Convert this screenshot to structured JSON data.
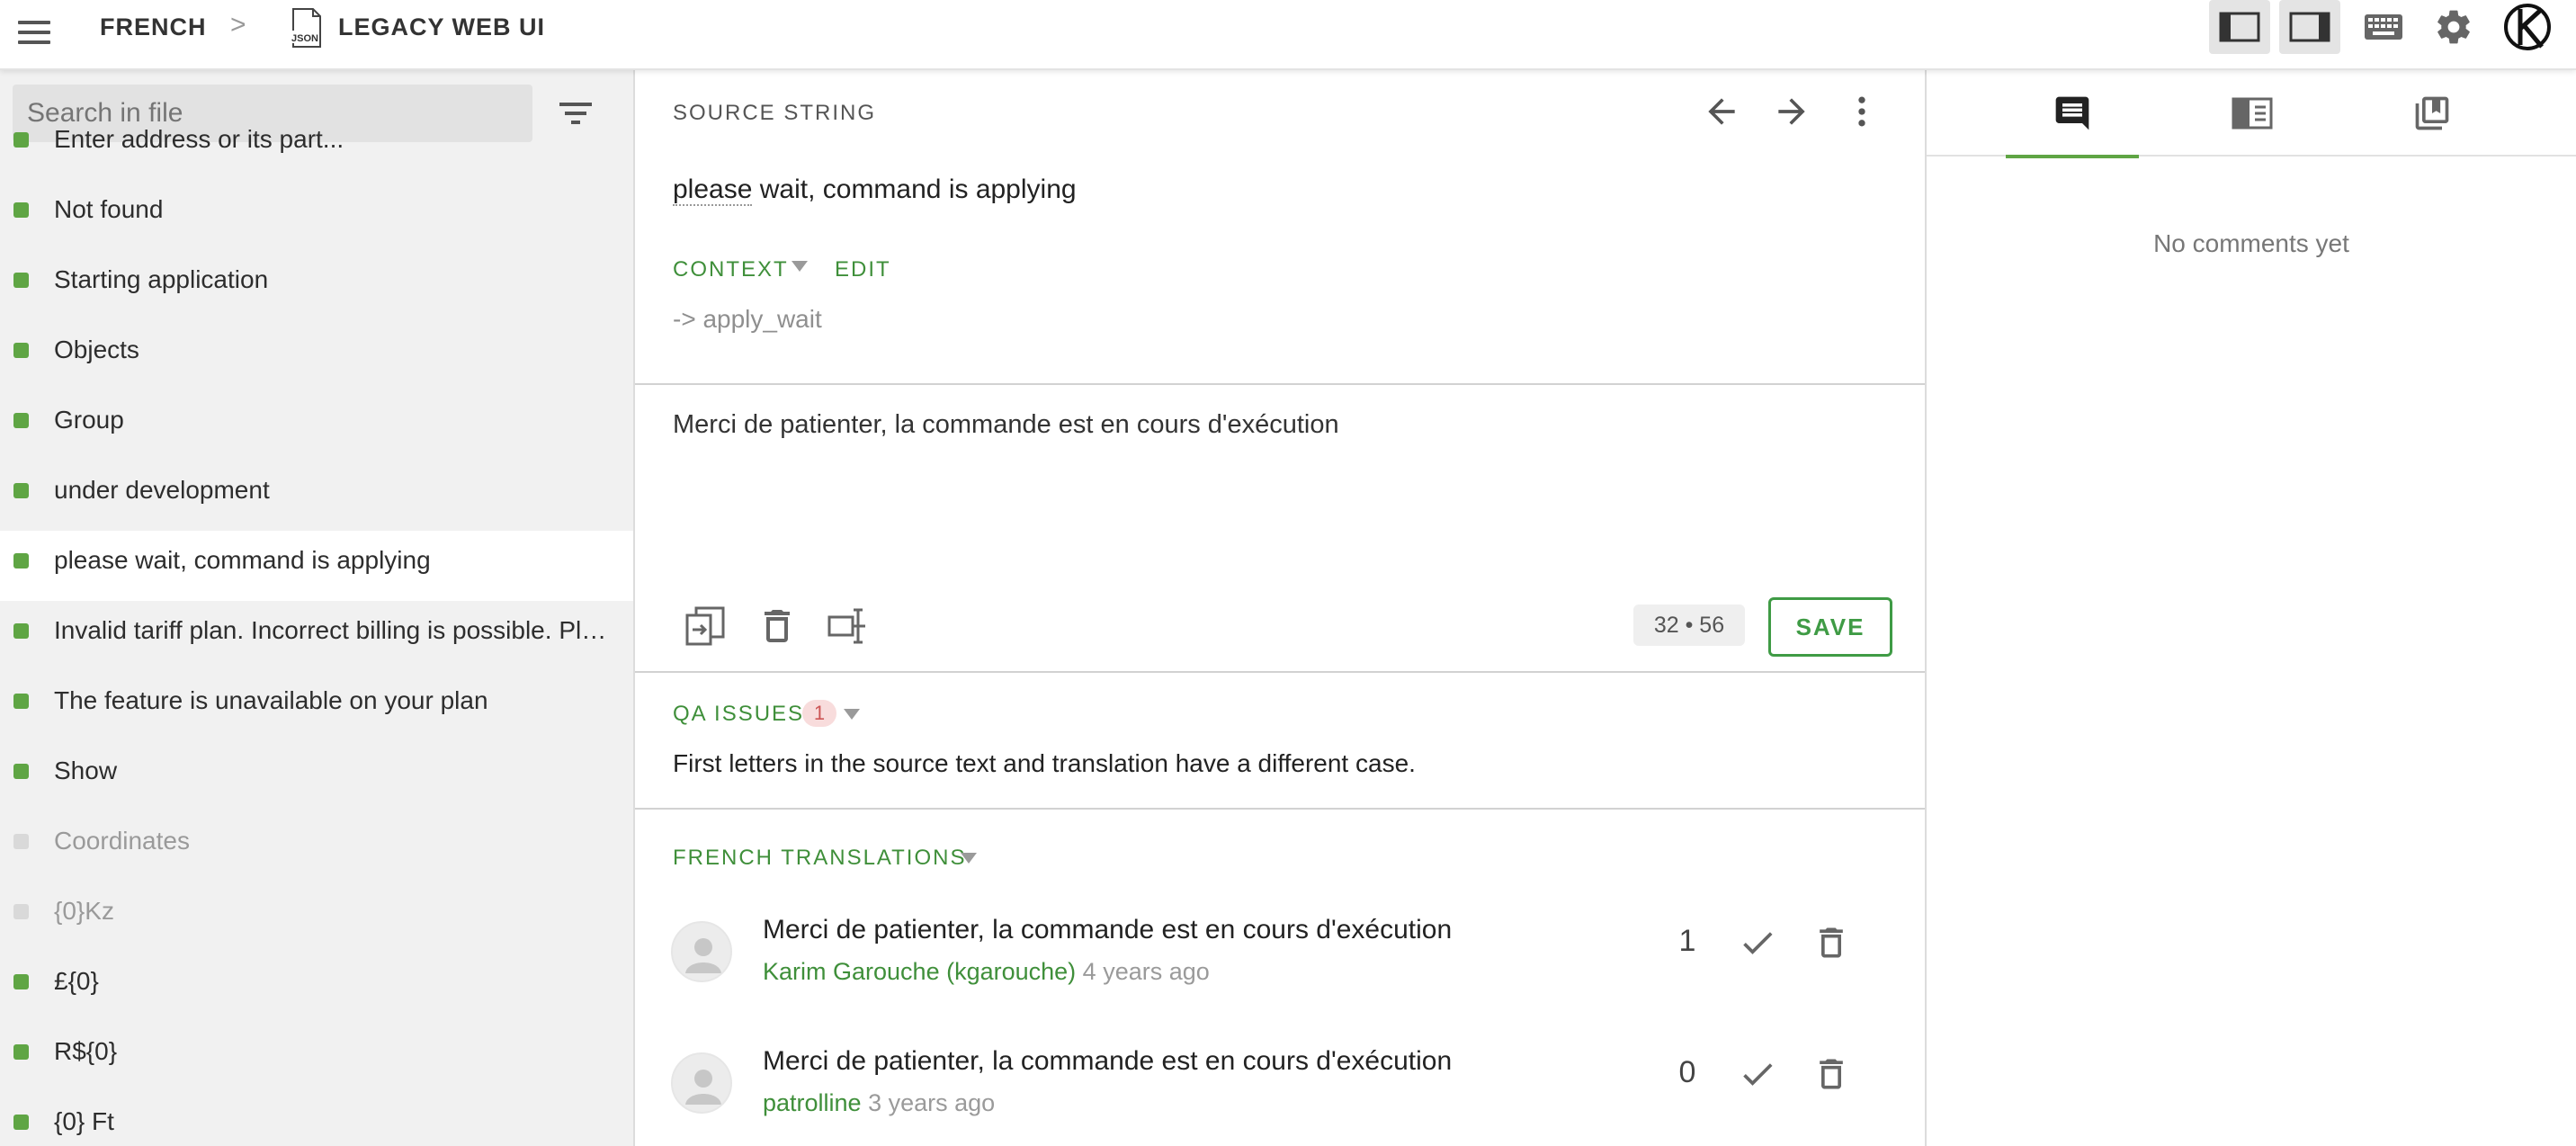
{
  "header": {
    "project_lang": "FRENCH",
    "separator": ">",
    "file_name": "LEGACY WEB UI",
    "icons": {
      "menu": "hamburger-icon",
      "file": "json-file-icon",
      "left_panel": "left-panel-toggle-icon",
      "right_panel": "right-panel-toggle-icon",
      "keyboard": "keyboard-icon",
      "settings": "gear-icon",
      "user": "user-avatar-icon"
    }
  },
  "sidebar": {
    "search_placeholder": "Search in file",
    "items": [
      {
        "label": "Enter address or its part...",
        "status": "translated"
      },
      {
        "label": "Not found",
        "status": "translated"
      },
      {
        "label": "Starting application",
        "status": "translated"
      },
      {
        "label": "Objects",
        "status": "translated"
      },
      {
        "label": "Group",
        "status": "translated"
      },
      {
        "label": "under development",
        "status": "translated"
      },
      {
        "label": "please wait, command is applying",
        "status": "translated",
        "selected": true
      },
      {
        "label": "Invalid tariff plan. Incorrect billing is possible. Please contact support",
        "status": "translated"
      },
      {
        "label": "The feature is unavailable on your plan",
        "status": "translated"
      },
      {
        "label": "Show",
        "status": "translated"
      },
      {
        "label": "Coordinates",
        "status": "pending"
      },
      {
        "label": "{0}Kz",
        "status": "pending"
      },
      {
        "label": "£{0}",
        "status": "translated"
      },
      {
        "label": "R${0}",
        "status": "translated"
      },
      {
        "label": "{0} Ft",
        "status": "translated"
      }
    ]
  },
  "editor": {
    "source_heading": "SOURCE STRING",
    "source_text_first": "please",
    "source_text_rest": " wait, command is applying",
    "context_label": "CONTEXT",
    "edit_label": "EDIT",
    "context_value": "-> apply_wait",
    "translation": "Merci de patienter, la commande est en cours d'exécution",
    "counter": "32 • 56",
    "save_label": "SAVE",
    "qa_heading": "QA ISSUES",
    "qa_count": "1",
    "qa_message": "First letters in the source text and translation have a different case.",
    "translations_heading": "FRENCH TRANSLATIONS",
    "suggestions": [
      {
        "text": "Merci de patienter, la commande est en cours d'exécution",
        "author": "Karim Garouche (kgarouche)",
        "time": "4 years ago",
        "votes": "1"
      },
      {
        "text": "Merci de patienter, la commande est en cours d'exécution",
        "author": "patrolline",
        "time": "3 years ago",
        "votes": "0"
      }
    ]
  },
  "rightpanel": {
    "tabs": [
      "comments-tab",
      "terms-tab",
      "translation-memory-tab"
    ],
    "empty_message": "No comments yet"
  },
  "colors": {
    "accent_green": "#3f8f3a",
    "status_translated": "#5fa544",
    "status_pending": "#d9d9d9",
    "qa_badge_bg": "#f8dcdc"
  }
}
